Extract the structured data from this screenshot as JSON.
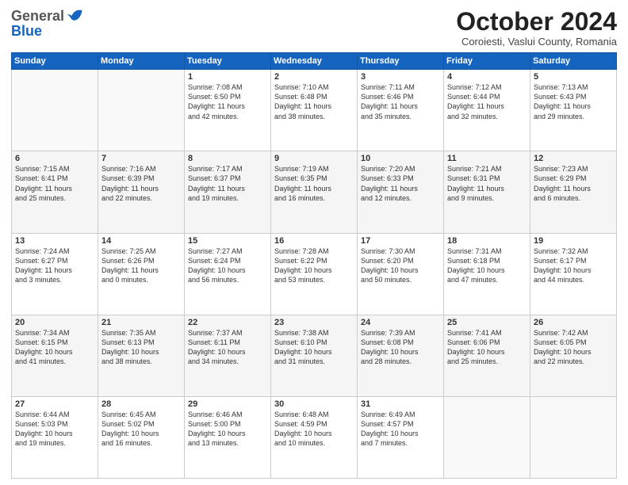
{
  "header": {
    "logo": {
      "line1": "General",
      "line2": "Blue"
    },
    "title": "October 2024",
    "location": "Coroiesti, Vaslui County, Romania"
  },
  "weekdays": [
    "Sunday",
    "Monday",
    "Tuesday",
    "Wednesday",
    "Thursday",
    "Friday",
    "Saturday"
  ],
  "weeks": [
    [
      {
        "day": "",
        "info": ""
      },
      {
        "day": "",
        "info": ""
      },
      {
        "day": "1",
        "info": "Sunrise: 7:08 AM\nSunset: 6:50 PM\nDaylight: 11 hours\nand 42 minutes."
      },
      {
        "day": "2",
        "info": "Sunrise: 7:10 AM\nSunset: 6:48 PM\nDaylight: 11 hours\nand 38 minutes."
      },
      {
        "day": "3",
        "info": "Sunrise: 7:11 AM\nSunset: 6:46 PM\nDaylight: 11 hours\nand 35 minutes."
      },
      {
        "day": "4",
        "info": "Sunrise: 7:12 AM\nSunset: 6:44 PM\nDaylight: 11 hours\nand 32 minutes."
      },
      {
        "day": "5",
        "info": "Sunrise: 7:13 AM\nSunset: 6:43 PM\nDaylight: 11 hours\nand 29 minutes."
      }
    ],
    [
      {
        "day": "6",
        "info": "Sunrise: 7:15 AM\nSunset: 6:41 PM\nDaylight: 11 hours\nand 25 minutes."
      },
      {
        "day": "7",
        "info": "Sunrise: 7:16 AM\nSunset: 6:39 PM\nDaylight: 11 hours\nand 22 minutes."
      },
      {
        "day": "8",
        "info": "Sunrise: 7:17 AM\nSunset: 6:37 PM\nDaylight: 11 hours\nand 19 minutes."
      },
      {
        "day": "9",
        "info": "Sunrise: 7:19 AM\nSunset: 6:35 PM\nDaylight: 11 hours\nand 16 minutes."
      },
      {
        "day": "10",
        "info": "Sunrise: 7:20 AM\nSunset: 6:33 PM\nDaylight: 11 hours\nand 12 minutes."
      },
      {
        "day": "11",
        "info": "Sunrise: 7:21 AM\nSunset: 6:31 PM\nDaylight: 11 hours\nand 9 minutes."
      },
      {
        "day": "12",
        "info": "Sunrise: 7:23 AM\nSunset: 6:29 PM\nDaylight: 11 hours\nand 6 minutes."
      }
    ],
    [
      {
        "day": "13",
        "info": "Sunrise: 7:24 AM\nSunset: 6:27 PM\nDaylight: 11 hours\nand 3 minutes."
      },
      {
        "day": "14",
        "info": "Sunrise: 7:25 AM\nSunset: 6:26 PM\nDaylight: 11 hours\nand 0 minutes."
      },
      {
        "day": "15",
        "info": "Sunrise: 7:27 AM\nSunset: 6:24 PM\nDaylight: 10 hours\nand 56 minutes."
      },
      {
        "day": "16",
        "info": "Sunrise: 7:28 AM\nSunset: 6:22 PM\nDaylight: 10 hours\nand 53 minutes."
      },
      {
        "day": "17",
        "info": "Sunrise: 7:30 AM\nSunset: 6:20 PM\nDaylight: 10 hours\nand 50 minutes."
      },
      {
        "day": "18",
        "info": "Sunrise: 7:31 AM\nSunset: 6:18 PM\nDaylight: 10 hours\nand 47 minutes."
      },
      {
        "day": "19",
        "info": "Sunrise: 7:32 AM\nSunset: 6:17 PM\nDaylight: 10 hours\nand 44 minutes."
      }
    ],
    [
      {
        "day": "20",
        "info": "Sunrise: 7:34 AM\nSunset: 6:15 PM\nDaylight: 10 hours\nand 41 minutes."
      },
      {
        "day": "21",
        "info": "Sunrise: 7:35 AM\nSunset: 6:13 PM\nDaylight: 10 hours\nand 38 minutes."
      },
      {
        "day": "22",
        "info": "Sunrise: 7:37 AM\nSunset: 6:11 PM\nDaylight: 10 hours\nand 34 minutes."
      },
      {
        "day": "23",
        "info": "Sunrise: 7:38 AM\nSunset: 6:10 PM\nDaylight: 10 hours\nand 31 minutes."
      },
      {
        "day": "24",
        "info": "Sunrise: 7:39 AM\nSunset: 6:08 PM\nDaylight: 10 hours\nand 28 minutes."
      },
      {
        "day": "25",
        "info": "Sunrise: 7:41 AM\nSunset: 6:06 PM\nDaylight: 10 hours\nand 25 minutes."
      },
      {
        "day": "26",
        "info": "Sunrise: 7:42 AM\nSunset: 6:05 PM\nDaylight: 10 hours\nand 22 minutes."
      }
    ],
    [
      {
        "day": "27",
        "info": "Sunrise: 6:44 AM\nSunset: 5:03 PM\nDaylight: 10 hours\nand 19 minutes."
      },
      {
        "day": "28",
        "info": "Sunrise: 6:45 AM\nSunset: 5:02 PM\nDaylight: 10 hours\nand 16 minutes."
      },
      {
        "day": "29",
        "info": "Sunrise: 6:46 AM\nSunset: 5:00 PM\nDaylight: 10 hours\nand 13 minutes."
      },
      {
        "day": "30",
        "info": "Sunrise: 6:48 AM\nSunset: 4:59 PM\nDaylight: 10 hours\nand 10 minutes."
      },
      {
        "day": "31",
        "info": "Sunrise: 6:49 AM\nSunset: 4:57 PM\nDaylight: 10 hours\nand 7 minutes."
      },
      {
        "day": "",
        "info": ""
      },
      {
        "day": "",
        "info": ""
      }
    ]
  ]
}
